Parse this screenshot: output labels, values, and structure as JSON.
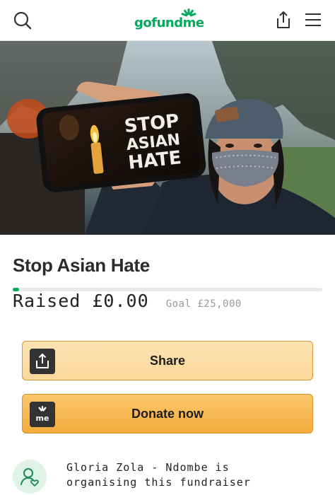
{
  "header": {
    "logo_text": "gofundme",
    "icons": [
      "search-icon",
      "share-icon",
      "menu-icon"
    ],
    "brand_color": "#02a95c"
  },
  "hero": {
    "phone_text_line1": "STOP",
    "phone_text_line2": "ASIAN",
    "phone_text_line3": "HATE"
  },
  "campaign": {
    "title": "Stop Asian Hate",
    "raised_label": "Raised",
    "raised_amount": "£0.00",
    "goal_label": "Goal £25,000",
    "progress_fraction": 0.02
  },
  "actions": {
    "share_label": "Share",
    "donate_label": "Donate now",
    "donate_icon_text": "me",
    "share_button_color": "#fbd79a",
    "donate_button_color": "#f4ad3e"
  },
  "organizer": {
    "line1": "Gloria Zola - Ndombe is",
    "line2": "organising this fundraiser",
    "avatar_icon": "user-heart-icon"
  }
}
